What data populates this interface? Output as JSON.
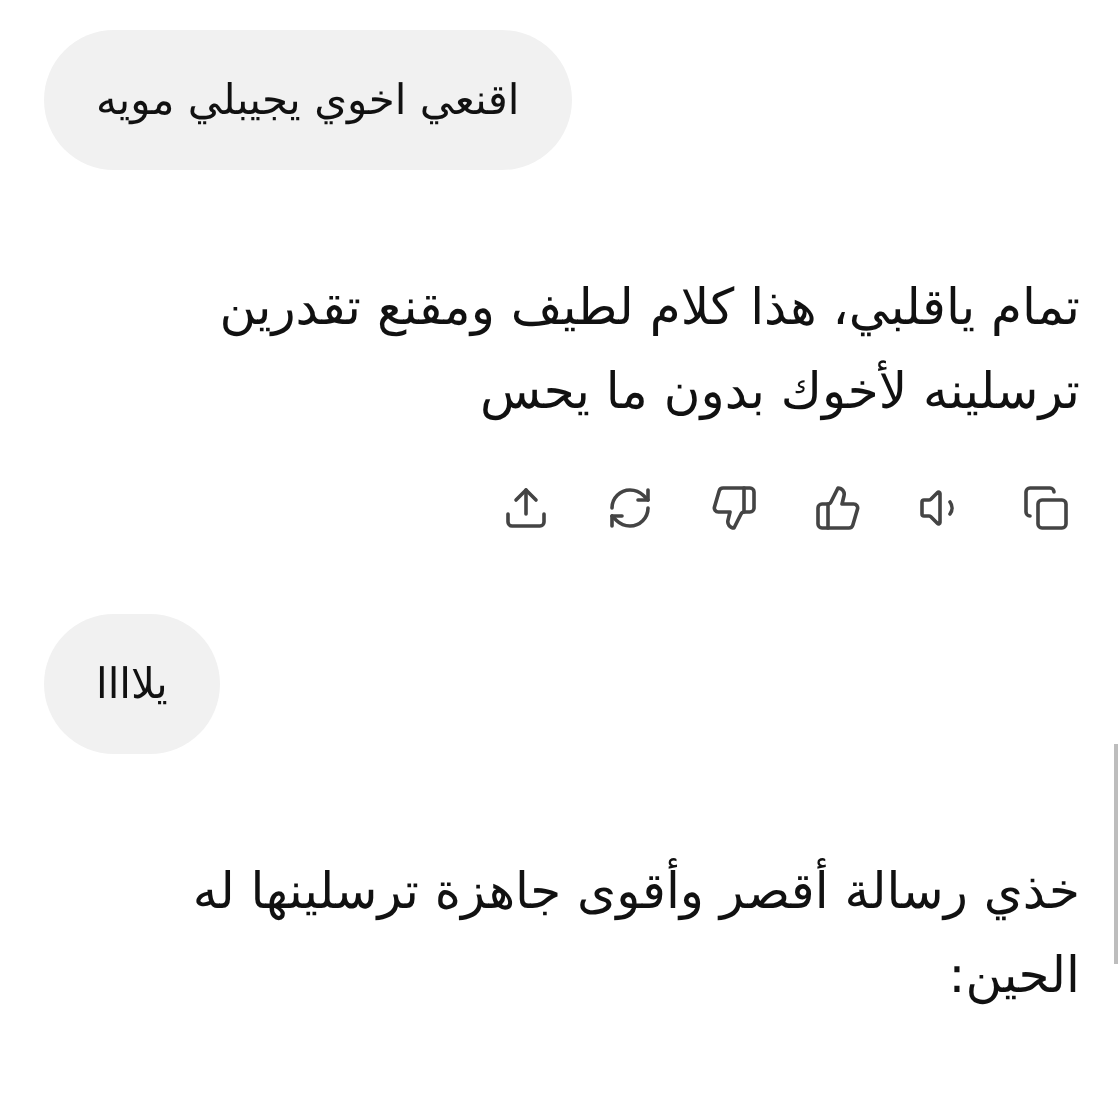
{
  "messages": [
    {
      "kind": "user",
      "text": "اقنعي اخوي يجيبلي مويه"
    },
    {
      "kind": "assistant",
      "text": "تمام ياقلبي، هذا كلام لطيف ومقنع تقدرين ترسلينه لأخوك بدون ما يحس",
      "actions": true
    },
    {
      "kind": "user",
      "text": "يلاااا"
    },
    {
      "kind": "assistant",
      "text": "خذي رسالة أقصر وأقوى جاهزة ترسلينها له الحين:",
      "actions": false
    }
  ]
}
